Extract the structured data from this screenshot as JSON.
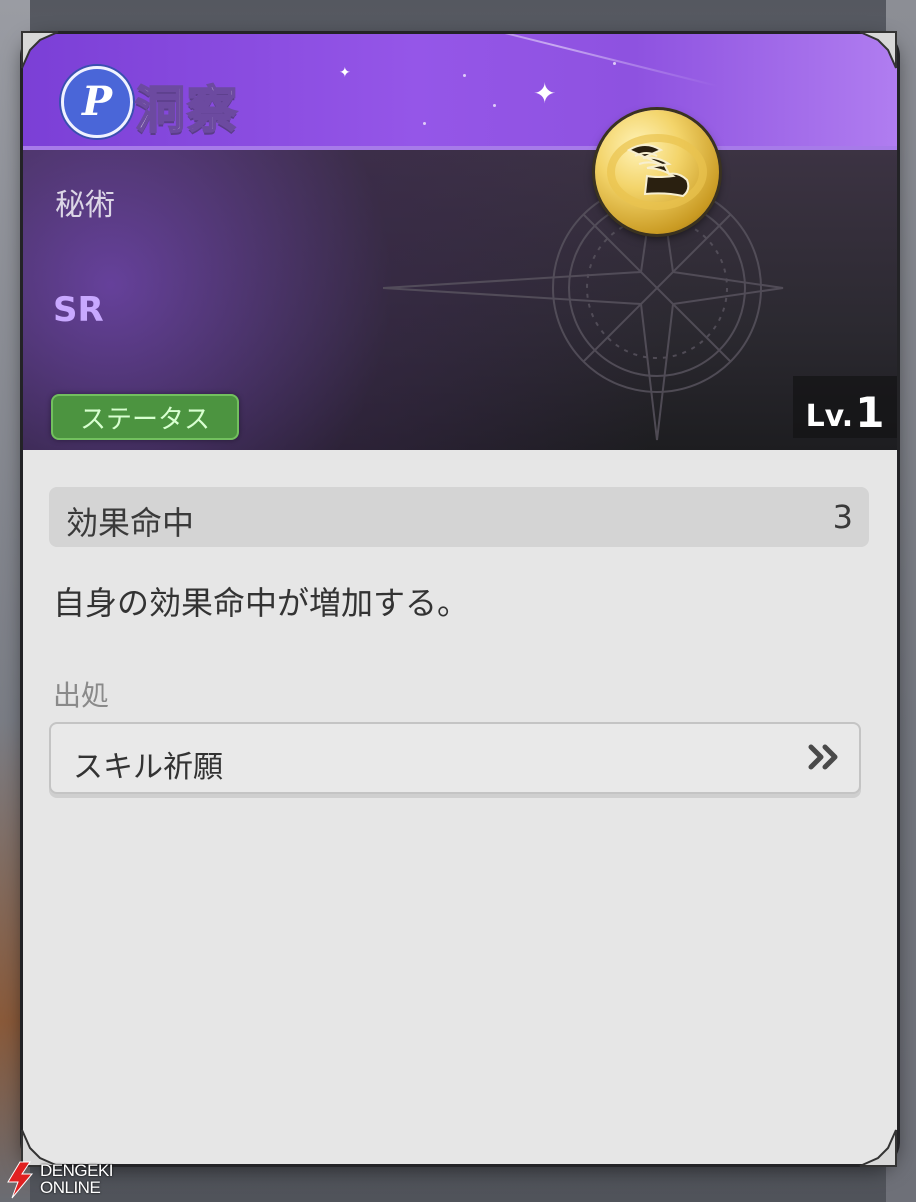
{
  "header": {
    "type_icon": "p-rune-icon",
    "title": "洞察"
  },
  "banner": {
    "category": "秘術",
    "rarity": "SR",
    "status_badge": "ステータス",
    "level_prefix": "Lv.",
    "level_value": "1",
    "emblem_icon": "winged-glove-icon"
  },
  "effect": {
    "name": "効果命中",
    "value": "3",
    "description": "自身の効果命中が増加する。"
  },
  "source": {
    "label": "出処",
    "button_text": "スキル祈願",
    "button_icon": "double-chevron-right-icon"
  },
  "watermark": {
    "line1": "DENGEKI",
    "line2": "ONLINE"
  },
  "colors": {
    "title_bar": "#8e52e0",
    "rarity": "#c8a8ff",
    "status_badge": "#4c9440",
    "card_body": "#e6e6e6"
  }
}
